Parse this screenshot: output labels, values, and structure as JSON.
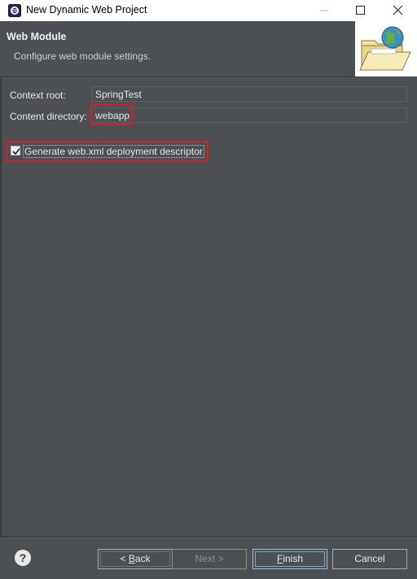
{
  "window": {
    "title": "New Dynamic Web Project",
    "controls": {
      "minimize": "—",
      "maximize": "☐",
      "close": "✕"
    }
  },
  "header": {
    "title": "Web Module",
    "description": "Configure web module settings.",
    "image_icon": "folder-globe-icon"
  },
  "form": {
    "context_root": {
      "label": "Context root:",
      "value": "SpringTest"
    },
    "content_directory": {
      "label": "Content directory:",
      "value": "webapp"
    },
    "generate_descriptor": {
      "label": "Generate web.xml deployment descriptor",
      "checked": true
    }
  },
  "footer": {
    "help_icon": "?",
    "back": {
      "prefix": "< ",
      "mnemonic": "B",
      "rest": "ack"
    },
    "next": "Next >",
    "finish": {
      "mnemonic": "F",
      "rest": "inish"
    },
    "cancel": "Cancel"
  },
  "colors": {
    "background": "#4c5052",
    "highlight": "#d3202b",
    "text": "#e6e6e6"
  }
}
